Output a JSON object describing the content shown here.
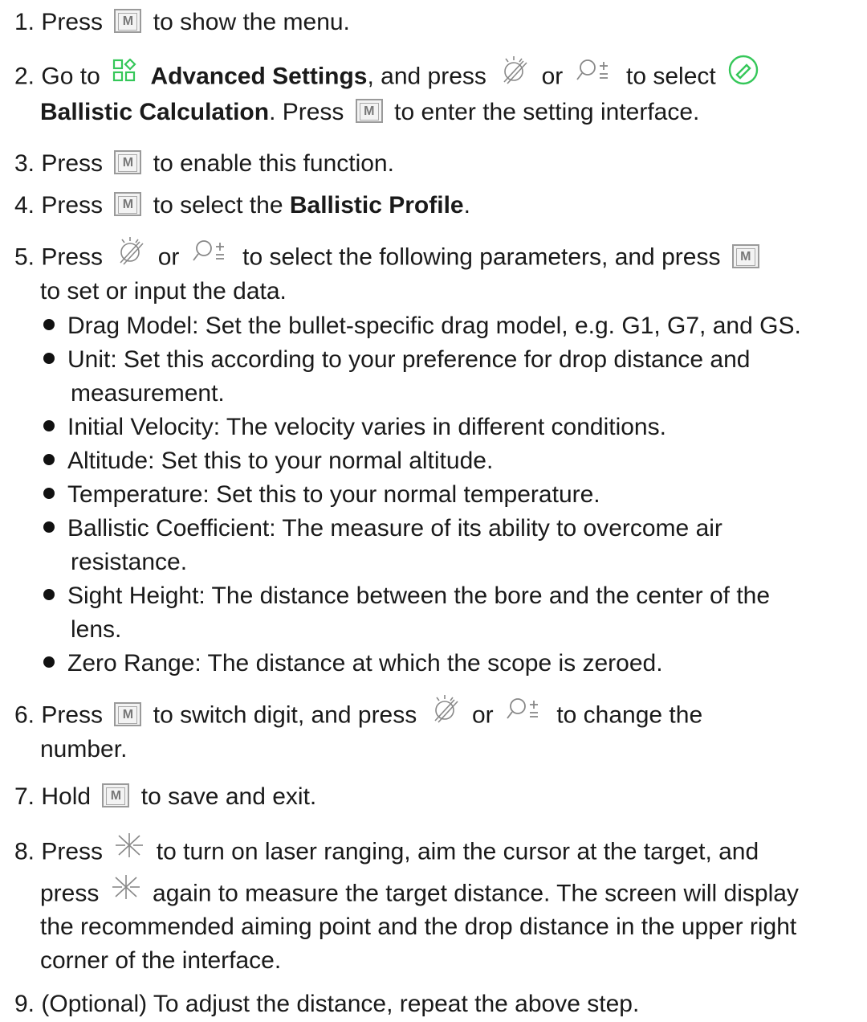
{
  "steps": [
    {
      "num": "1.",
      "a": "Press",
      "b": "to show the menu."
    },
    {
      "num": "2.",
      "a": "Go to",
      "bold1": "Advanced Settings",
      "b": ", and press",
      "or": "or",
      "c": "to select",
      "bold2": "Ballistic Calculation",
      "d": ". Press",
      "e": "to enter the setting interface."
    },
    {
      "num": "3.",
      "a": "Press",
      "b": "to enable this function."
    },
    {
      "num": "4.",
      "a": "Press",
      "b": "to select the",
      "bold1": "Ballistic Profile",
      "c": "."
    },
    {
      "num": "5.",
      "a": "Press",
      "or": "or",
      "b": "to select the following parameters, and press",
      "c": "to set or input the data."
    },
    {
      "num": "6.",
      "a": "Press",
      "b": "to switch digit, and press",
      "or": "or",
      "c": "to change the",
      "d": "number."
    },
    {
      "num": "7.",
      "a": "Hold",
      "b": "to save and exit."
    },
    {
      "num": "8.",
      "a": "Press",
      "b": "to turn on laser ranging, aim the cursor at the target, and",
      "c": "press",
      "d": "again to measure the target distance. The screen will display",
      "e": "the recommended aiming point and the drop distance in the upper right",
      "f": "corner of the interface."
    },
    {
      "num": "9.",
      "a": "(Optional) To adjust the distance, repeat the above step."
    }
  ],
  "bullets": [
    {
      "l1": "Drag Model: Set the bullet-specific drag model, e.g. G1, G7, and GS."
    },
    {
      "l1": "Unit: Set this according to your preference for drop distance and",
      "l2": "measurement."
    },
    {
      "l1": "Initial Velocity: The velocity varies in different conditions."
    },
    {
      "l1": "Altitude: Set this to your normal altitude."
    },
    {
      "l1": "Temperature: Set this to your normal temperature."
    },
    {
      "l1": "Ballistic Coefficient: The measure of its ability to overcome air",
      "l2": "resistance."
    },
    {
      "l1": "Sight Height: The distance between the bore and the center of the",
      "l2": "lens."
    },
    {
      "l1": "Zero Range: The distance at which the scope is zeroed."
    }
  ],
  "icons": {
    "m": "M",
    "m_button": "m-button-icon",
    "advanced_settings": "grid-settings-icon",
    "brightness": "brightness-dial-icon",
    "zoom": "zoom-plus-minus-icon",
    "ballistic": "ballistic-calculation-icon",
    "laser": "laser-star-icon",
    "accent_color": "#35c759"
  }
}
